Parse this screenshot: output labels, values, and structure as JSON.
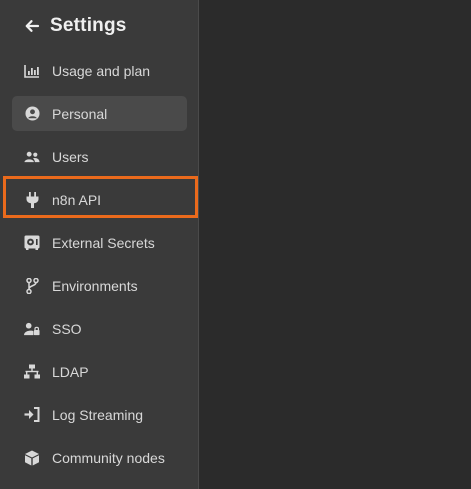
{
  "header": {
    "title": "Settings"
  },
  "sidebar": {
    "items": [
      {
        "label": "Usage and plan",
        "icon": "bar-chart-icon"
      },
      {
        "label": "Personal",
        "icon": "user-circle-icon",
        "active": true
      },
      {
        "label": "Users",
        "icon": "users-icon"
      },
      {
        "label": "n8n API",
        "icon": "plug-icon",
        "highlighted": true
      },
      {
        "label": "External Secrets",
        "icon": "vault-icon"
      },
      {
        "label": "Environments",
        "icon": "code-branch-icon"
      },
      {
        "label": "SSO",
        "icon": "user-lock-icon"
      },
      {
        "label": "LDAP",
        "icon": "network-wired-icon"
      },
      {
        "label": "Log Streaming",
        "icon": "sign-in-icon"
      },
      {
        "label": "Community nodes",
        "icon": "cube-icon"
      }
    ]
  },
  "colors": {
    "sidebar_bg": "#3a3a3a",
    "main_bg": "#2b2b2b",
    "active_bg": "#4a4a4a",
    "highlight": "#ea6a1c",
    "text": "#d8d8d8"
  }
}
